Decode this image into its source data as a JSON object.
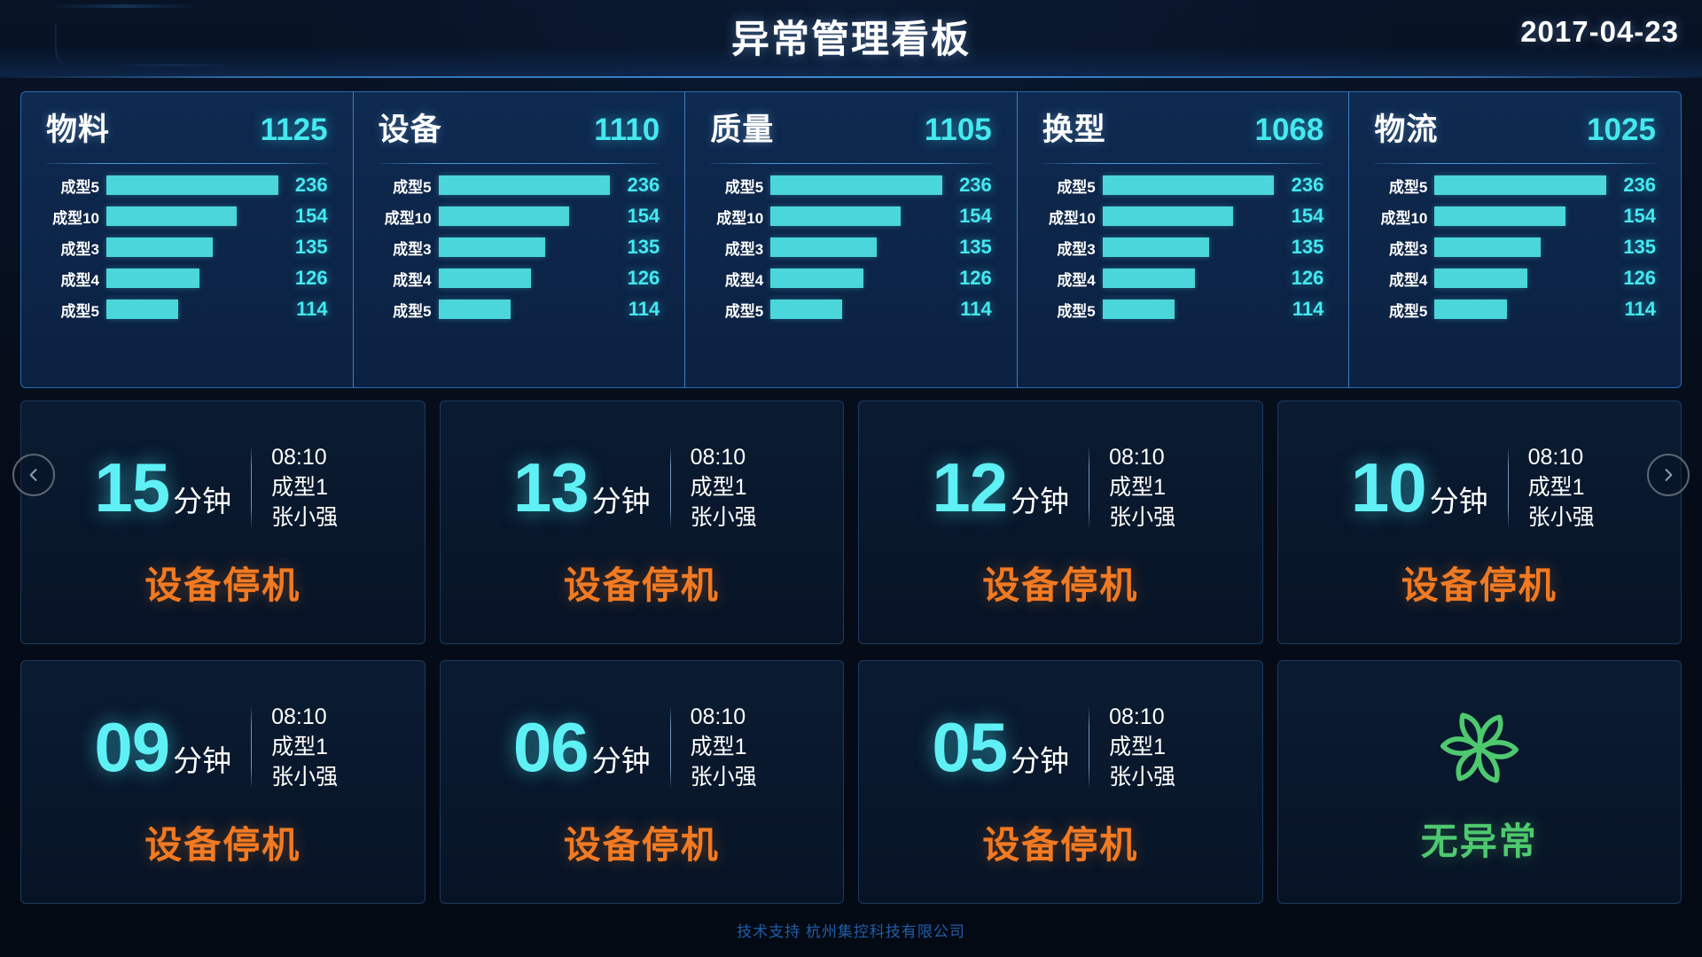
{
  "header": {
    "title": "异常管理看板",
    "date": "2017-04-23"
  },
  "kpi_panels": [
    {
      "title": "物料",
      "total": "1125",
      "rows": [
        {
          "label": "成型5",
          "value": "236",
          "pct": 100
        },
        {
          "label": "成型10",
          "value": "154",
          "pct": 76
        },
        {
          "label": "成型3",
          "value": "135",
          "pct": 62
        },
        {
          "label": "成型4",
          "value": "126",
          "pct": 54
        },
        {
          "label": "成型5",
          "value": "114",
          "pct": 42
        }
      ]
    },
    {
      "title": "设备",
      "total": "1110",
      "rows": [
        {
          "label": "成型5",
          "value": "236",
          "pct": 100
        },
        {
          "label": "成型10",
          "value": "154",
          "pct": 76
        },
        {
          "label": "成型3",
          "value": "135",
          "pct": 62
        },
        {
          "label": "成型4",
          "value": "126",
          "pct": 54
        },
        {
          "label": "成型5",
          "value": "114",
          "pct": 42
        }
      ]
    },
    {
      "title": "质量",
      "total": "1105",
      "rows": [
        {
          "label": "成型5",
          "value": "236",
          "pct": 100
        },
        {
          "label": "成型10",
          "value": "154",
          "pct": 76
        },
        {
          "label": "成型3",
          "value": "135",
          "pct": 62
        },
        {
          "label": "成型4",
          "value": "126",
          "pct": 54
        },
        {
          "label": "成型5",
          "value": "114",
          "pct": 42
        }
      ]
    },
    {
      "title": "换型",
      "total": "1068",
      "rows": [
        {
          "label": "成型5",
          "value": "236",
          "pct": 100
        },
        {
          "label": "成型10",
          "value": "154",
          "pct": 76
        },
        {
          "label": "成型3",
          "value": "135",
          "pct": 62
        },
        {
          "label": "成型4",
          "value": "126",
          "pct": 54
        },
        {
          "label": "成型5",
          "value": "114",
          "pct": 42
        }
      ]
    },
    {
      "title": "物流",
      "total": "1025",
      "rows": [
        {
          "label": "成型5",
          "value": "236",
          "pct": 100
        },
        {
          "label": "成型10",
          "value": "154",
          "pct": 76
        },
        {
          "label": "成型3",
          "value": "135",
          "pct": 62
        },
        {
          "label": "成型4",
          "value": "126",
          "pct": 54
        },
        {
          "label": "成型5",
          "value": "114",
          "pct": 42
        }
      ]
    }
  ],
  "alert_unit": "分钟",
  "alerts": [
    {
      "kind": "alert",
      "minutes": "15",
      "time": "08:10",
      "line": "成型1",
      "person": "张小强",
      "status": "设备停机"
    },
    {
      "kind": "alert",
      "minutes": "13",
      "time": "08:10",
      "line": "成型1",
      "person": "张小强",
      "status": "设备停机"
    },
    {
      "kind": "alert",
      "minutes": "12",
      "time": "08:10",
      "line": "成型1",
      "person": "张小强",
      "status": "设备停机"
    },
    {
      "kind": "alert",
      "minutes": "10",
      "time": "08:10",
      "line": "成型1",
      "person": "张小强",
      "status": "设备停机"
    },
    {
      "kind": "alert",
      "minutes": "09",
      "time": "08:10",
      "line": "成型1",
      "person": "张小强",
      "status": "设备停机"
    },
    {
      "kind": "alert",
      "minutes": "06",
      "time": "08:10",
      "line": "成型1",
      "person": "张小强",
      "status": "设备停机"
    },
    {
      "kind": "alert",
      "minutes": "05",
      "time": "08:10",
      "line": "成型1",
      "person": "张小强",
      "status": "设备停机"
    },
    {
      "kind": "normal",
      "status": "无异常",
      "icon": "pinwheel-icon"
    }
  ],
  "nav": {
    "prev_icon": "chevron-left-icon",
    "next_icon": "chevron-right-icon"
  },
  "footer": {
    "text": "技术支持 杭州集控科技有限公司"
  },
  "colors": {
    "accent_cyan": "#45e8f0",
    "bar_cyan": "#4ad6da",
    "alert_orange": "#f27a22",
    "normal_green": "#4ec96f",
    "panel_bg": "#0b2142",
    "panel_border": "#2a6ab0",
    "card_bg": "#0a1b31",
    "card_border": "#1c3a5e",
    "page_bg": "#050c18",
    "footer_blue": "#1f5ea8"
  }
}
